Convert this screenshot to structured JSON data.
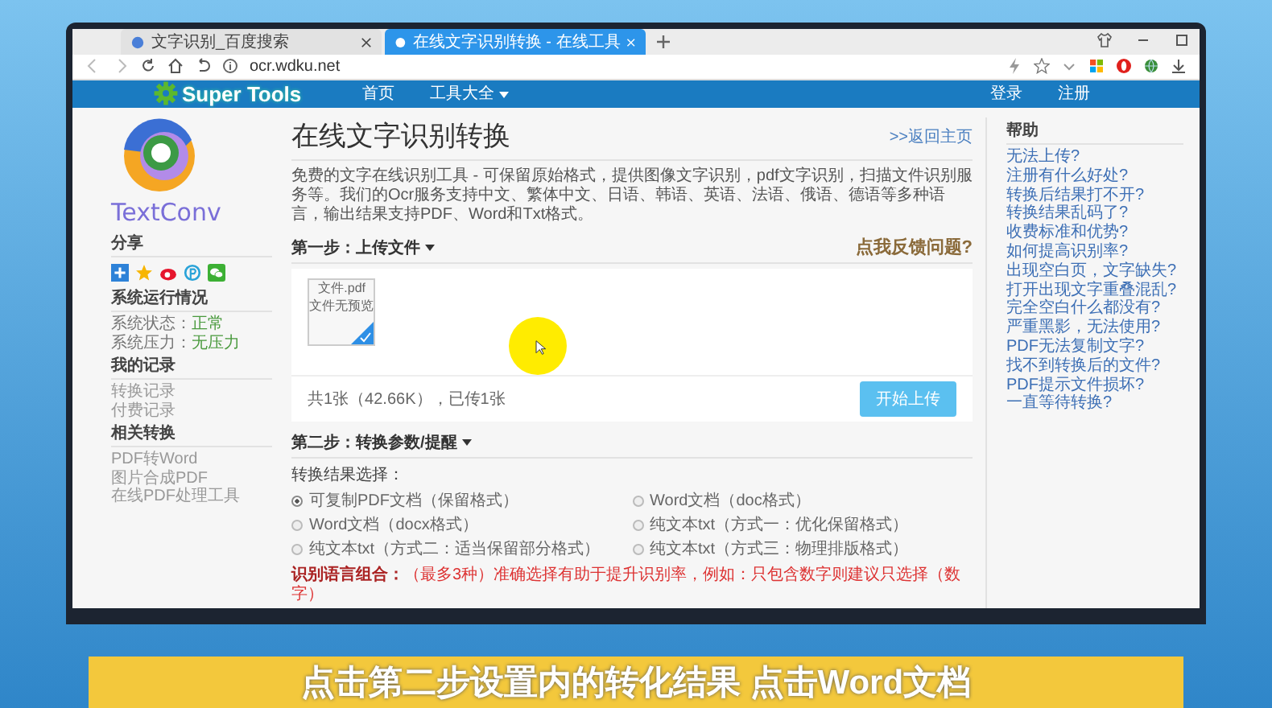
{
  "browser": {
    "tabs": [
      {
        "title": "文字识别_百度搜索",
        "selected": false
      },
      {
        "title": "在线文字识别转换 - 在线工具",
        "selected": true
      }
    ],
    "address": "ocr.wdku.net"
  },
  "site_nav": {
    "logo": "Super Tools",
    "links": [
      {
        "label": "首页",
        "dropdown": false
      },
      {
        "label": "工具大全",
        "dropdown": true
      }
    ],
    "account_links": [
      "登录",
      "注册"
    ]
  },
  "sidebar": {
    "logo_text": "TextConv",
    "sections": [
      {
        "title": "分享",
        "kind": "share"
      },
      {
        "title": "系统运行情况",
        "kind": "status",
        "items": [
          {
            "label": "系统状态：",
            "value": "正常"
          },
          {
            "label": "系统压力：",
            "value": "无压力"
          }
        ]
      },
      {
        "title": "我的记录",
        "kind": "links",
        "items": [
          "转换记录",
          "付费记录"
        ]
      },
      {
        "title": "相关转换",
        "kind": "links",
        "items": [
          "PDF转Word",
          "图片合成PDF",
          "在线PDF处理工具"
        ]
      }
    ]
  },
  "main": {
    "title": "在线文字识别转换",
    "back_link": ">>返回主页",
    "description": "免费的文字在线识别工具 - 可保留原始格式，提供图像文字识别，pdf文字识别，扫描文件识别服务等。我们的Ocr服务支持中文、繁体中文、日语、韩语、英语、法语、俄语、德语等多种语言，输出结果支持PDF、Word和Txt格式。",
    "step1": {
      "title": "第一步：上传文件",
      "dropdown": true,
      "feedback_link": "点我反馈问题?"
    },
    "upload": {
      "file": {
        "name": "文件.pdf",
        "preview": "文件无预览",
        "checked": true
      },
      "summary": "共1张（42.66K），已传1张",
      "button": "开始上传"
    },
    "step2": {
      "title": "第二步：转换参数/提醒",
      "dropdown": true,
      "result_label": "转换结果选择：",
      "options": [
        {
          "label": "可复制PDF文档（保留格式）",
          "selected": true
        },
        {
          "label": "Word文档（doc格式）",
          "selected": false
        },
        {
          "label": "Word文档（docx格式）",
          "selected": false
        },
        {
          "label": "纯文本txt（方式一：优化保留格式）",
          "selected": false
        },
        {
          "label": "纯文本txt（方式二：适当保留部分格式）",
          "selected": false
        },
        {
          "label": "纯文本txt（方式三：物理排版格式）",
          "selected": false
        }
      ],
      "language_label": "识别语言组合：",
      "language_hint": "（最多3种）准确选择有助于提升识别率，例如：只包含数字则建议只选择（数字）"
    }
  },
  "help": {
    "title": "帮助",
    "links": [
      "无法上传?",
      "注册有什么好处?",
      "转换后结果打不开?",
      "转换结果乱码了?",
      "收费标准和优势?",
      "如何提高识别率?",
      "出现空白页，文字缺失?",
      "打开出现文字重叠混乱?",
      "完全空白什么都没有?",
      "严重黑影，无法使用?",
      "PDF无法复制文字?",
      "找不到转换后的文件?",
      "PDF提示文件损坏?",
      "一直等待转换?"
    ]
  },
  "caption": "点击第二步设置内的转化结果 点击Word文档"
}
